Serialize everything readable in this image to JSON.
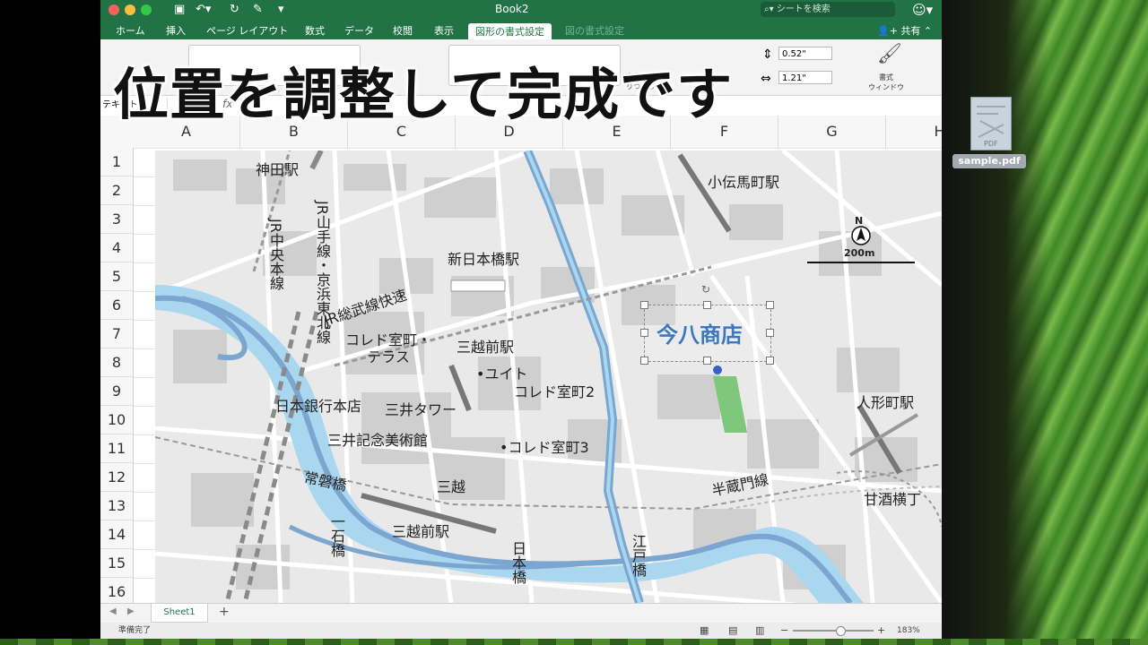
{
  "app": {
    "title": "Book2",
    "search_placeholder": "シートを検索",
    "share_label": "共有"
  },
  "ribbon_tabs": [
    "ホーム",
    "挿入",
    "ページ レイアウト",
    "数式",
    "データ",
    "校閲",
    "表示",
    "図形の書式設定",
    "図の書式設定"
  ],
  "ribbon": {
    "height_value": "0.52\"",
    "width_value": "1.21\"",
    "text_fill_label": "文字の\nりつぶし",
    "format_window_label": "書式\nウィンドウ"
  },
  "formula_bar": {
    "name_box": "テキスト",
    "fx": "fx"
  },
  "columns": [
    "A",
    "B",
    "C",
    "D",
    "E",
    "F",
    "G",
    "H"
  ],
  "rows": [
    "1",
    "2",
    "3",
    "4",
    "5",
    "6",
    "7",
    "8",
    "9",
    "10",
    "11",
    "12",
    "13",
    "14",
    "15",
    "16"
  ],
  "overlay_caption": "位置を調整して完成です",
  "map": {
    "labels": {
      "kanda": "神田駅",
      "kodenmacho": "小伝馬町駅",
      "shin_nihonbashi": "新日本橋駅",
      "jr_yamanote": "JR山手線・京浜東北線",
      "jr_chuo": "JR中央本線",
      "sobu": "JR総武線快速",
      "coredo_terrace": "コレド室町・\nテラス",
      "mitsukoshimae_top": "三越前駅",
      "yuito": "•ユイト",
      "coredo2": "コレド室町2",
      "boj": "日本銀行本店",
      "mitsui_tower": "三井タワー",
      "mitsui_museum": "三井記念美術館",
      "coredo3": "•コレド室町3",
      "tokiwabashi": "常磐橋",
      "mitsukoshi": "三越",
      "ichikokubashi": "一石橋",
      "mitsukoshimae_bottom": "三越前駅",
      "nihonbashi": "日本橋",
      "edobashi": "江戸橋",
      "hanzomon": "半蔵門線",
      "ningyocho": "人形町駅",
      "amazake": "甘酒横丁",
      "scale": "200m",
      "north": "N"
    },
    "shop_name": "今八商店"
  },
  "desktop_file": {
    "name": "sample.pdf",
    "badge": "PDF"
  },
  "sheet_tab": "Sheet1",
  "status": {
    "ready": "準備完了",
    "zoom": "183%"
  },
  "colors": {
    "excel_green": "#217346",
    "river": "#a9d7f0",
    "road_blue": "#7ba6cf",
    "shop_text": "#3a78c2",
    "park": "#7fc77a"
  }
}
